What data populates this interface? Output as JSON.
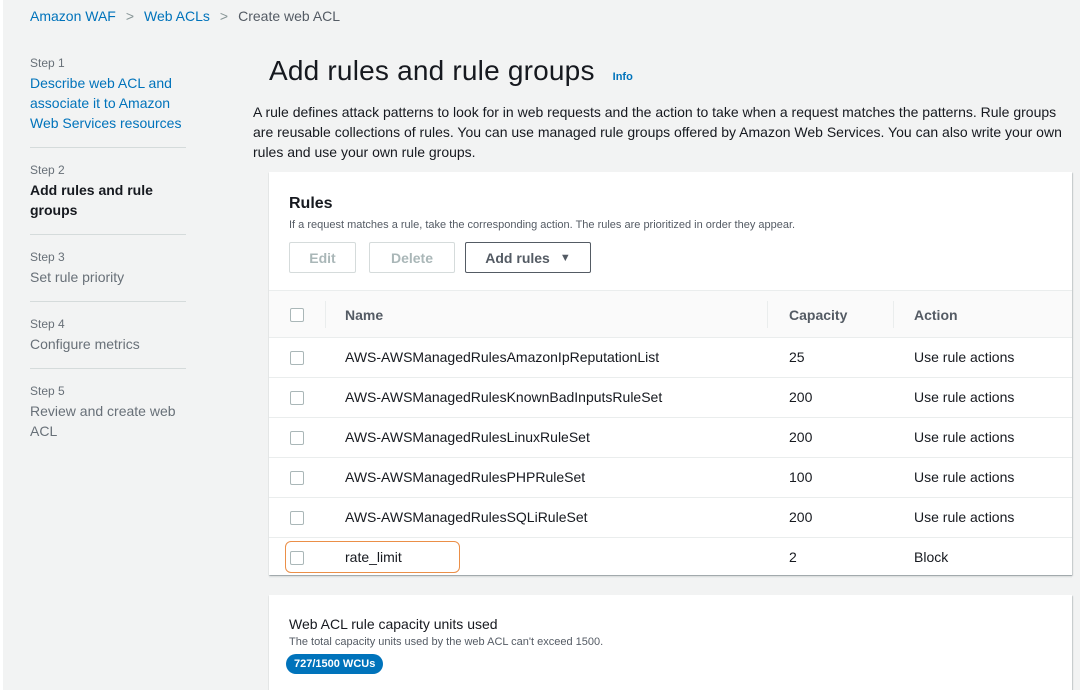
{
  "breadcrumb": [
    {
      "label": "Amazon WAF"
    },
    {
      "label": "Web ACLs"
    },
    {
      "label": "Create web ACL"
    }
  ],
  "steps": [
    {
      "num": "Step 1",
      "title": "Describe web ACL and associate it to Amazon Web Services resources",
      "state": "link"
    },
    {
      "num": "Step 2",
      "title": "Add rules and rule groups",
      "state": "active"
    },
    {
      "num": "Step 3",
      "title": "Set rule priority",
      "state": "disabled"
    },
    {
      "num": "Step 4",
      "title": "Configure metrics",
      "state": "disabled"
    },
    {
      "num": "Step 5",
      "title": "Review and create web ACL",
      "state": "disabled"
    }
  ],
  "page": {
    "title": "Add rules and rule groups",
    "info": "Info",
    "description": "A rule defines attack patterns to look for in web requests and the action to take when a request matches the patterns. Rule groups are reusable collections of rules. You can use managed rule groups offered by Amazon Web Services. You can also write your own rules and use your own rule groups."
  },
  "rules": {
    "title": "Rules",
    "subtitle": "If a request matches a rule, take the corresponding action. The rules are prioritized in order they appear.",
    "edit_label": "Edit",
    "delete_label": "Delete",
    "add_label": "Add rules",
    "columns": {
      "name": "Name",
      "capacity": "Capacity",
      "action": "Action"
    },
    "rows": [
      {
        "name": "AWS-AWSManagedRulesAmazonIpReputationList",
        "capacity": "25",
        "action": "Use rule actions"
      },
      {
        "name": "AWS-AWSManagedRulesKnownBadInputsRuleSet",
        "capacity": "200",
        "action": "Use rule actions"
      },
      {
        "name": "AWS-AWSManagedRulesLinuxRuleSet",
        "capacity": "200",
        "action": "Use rule actions"
      },
      {
        "name": "AWS-AWSManagedRulesPHPRuleSet",
        "capacity": "100",
        "action": "Use rule actions"
      },
      {
        "name": "AWS-AWSManagedRulesSQLiRuleSet",
        "capacity": "200",
        "action": "Use rule actions"
      },
      {
        "name": "rate_limit",
        "capacity": "2",
        "action": "Block"
      }
    ]
  },
  "capacity": {
    "title": "Web ACL rule capacity units used",
    "subtitle": "The total capacity units used by the web ACL can't exceed 1500.",
    "badge": "727/1500 WCUs"
  },
  "colors": {
    "link": "#0073bb",
    "highlight": "#eb8f48",
    "badge": "#0073bb"
  }
}
